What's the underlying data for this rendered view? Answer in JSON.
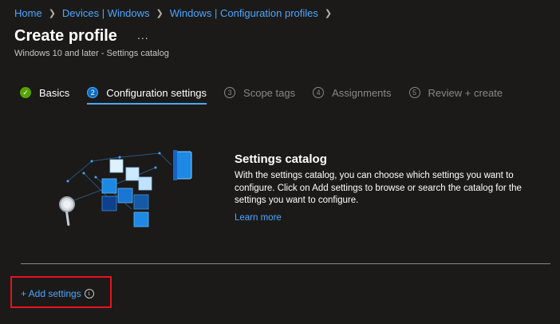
{
  "breadcrumb": [
    "Home",
    "Devices | Windows",
    "Windows | Configuration profiles"
  ],
  "header": {
    "title": "Create profile",
    "more": "...",
    "subtitle": "Windows 10 and later - Settings catalog"
  },
  "steps": [
    {
      "number": "",
      "label": "Basics",
      "state": "completed"
    },
    {
      "number": "2",
      "label": "Configuration settings",
      "state": "active"
    },
    {
      "number": "3",
      "label": "Scope tags",
      "state": "pending"
    },
    {
      "number": "4",
      "label": "Assignments",
      "state": "pending"
    },
    {
      "number": "5",
      "label": "Review + create",
      "state": "pending"
    }
  ],
  "catalog": {
    "title": "Settings catalog",
    "description": "With the settings catalog, you can choose which settings you want to configure. Click on Add settings to browse or search the catalog for the settings you want to configure.",
    "learn_more": "Learn more"
  },
  "actions": {
    "add_settings": "+ Add settings",
    "info_icon": "i"
  },
  "colors": {
    "background": "#1b1a19",
    "link": "#4ca6ff",
    "accent": "#0f6cbd",
    "success": "#57a300",
    "highlight": "#e81123"
  },
  "icons": {
    "step_completed": "checkmark-icon",
    "info": "info-icon",
    "separator": "chevron-right-icon"
  }
}
